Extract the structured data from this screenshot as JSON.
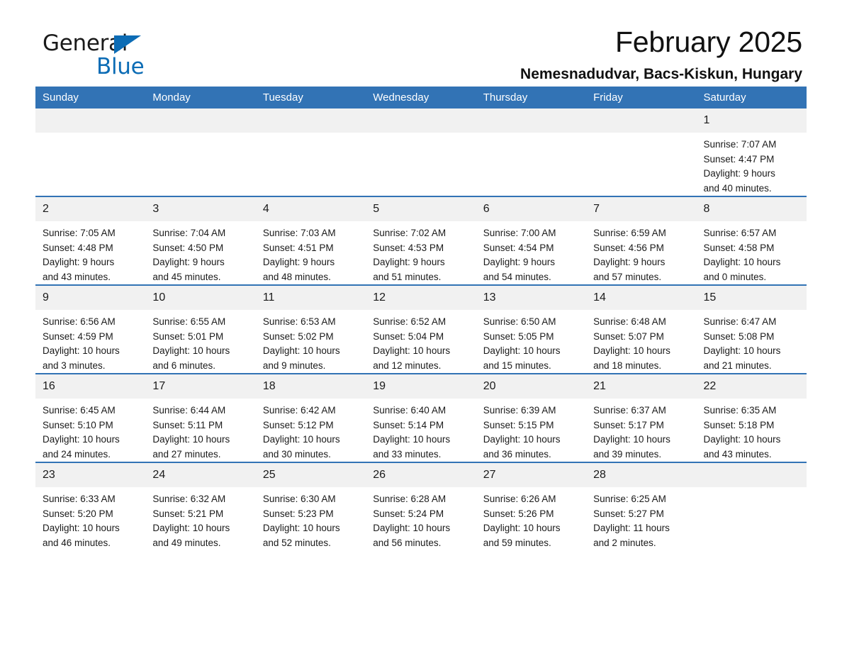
{
  "brand": {
    "name_part1": "General",
    "name_part2": "Blue",
    "triangle_color": "#0c6cb5"
  },
  "header": {
    "title": "February 2025",
    "subtitle": "Nemesnadudvar, Bacs-Kiskun, Hungary"
  },
  "colors": {
    "header_blue": "#3273b5",
    "day_band_gray": "#f1f1f1",
    "brand_blue": "#0c6cb5"
  },
  "weekday_headers": [
    "Sunday",
    "Monday",
    "Tuesday",
    "Wednesday",
    "Thursday",
    "Friday",
    "Saturday"
  ],
  "weeks": [
    [
      {
        "day": "",
        "sunrise": "",
        "sunset": "",
        "daylight_line1": "",
        "daylight_line2": "",
        "empty": true
      },
      {
        "day": "",
        "sunrise": "",
        "sunset": "",
        "daylight_line1": "",
        "daylight_line2": "",
        "empty": true
      },
      {
        "day": "",
        "sunrise": "",
        "sunset": "",
        "daylight_line1": "",
        "daylight_line2": "",
        "empty": true
      },
      {
        "day": "",
        "sunrise": "",
        "sunset": "",
        "daylight_line1": "",
        "daylight_line2": "",
        "empty": true
      },
      {
        "day": "",
        "sunrise": "",
        "sunset": "",
        "daylight_line1": "",
        "daylight_line2": "",
        "empty": true
      },
      {
        "day": "",
        "sunrise": "",
        "sunset": "",
        "daylight_line1": "",
        "daylight_line2": "",
        "empty": true
      },
      {
        "day": "1",
        "sunrise": "Sunrise: 7:07 AM",
        "sunset": "Sunset: 4:47 PM",
        "daylight_line1": "Daylight: 9 hours",
        "daylight_line2": "and 40 minutes.",
        "empty": false
      }
    ],
    [
      {
        "day": "2",
        "sunrise": "Sunrise: 7:05 AM",
        "sunset": "Sunset: 4:48 PM",
        "daylight_line1": "Daylight: 9 hours",
        "daylight_line2": "and 43 minutes.",
        "empty": false
      },
      {
        "day": "3",
        "sunrise": "Sunrise: 7:04 AM",
        "sunset": "Sunset: 4:50 PM",
        "daylight_line1": "Daylight: 9 hours",
        "daylight_line2": "and 45 minutes.",
        "empty": false
      },
      {
        "day": "4",
        "sunrise": "Sunrise: 7:03 AM",
        "sunset": "Sunset: 4:51 PM",
        "daylight_line1": "Daylight: 9 hours",
        "daylight_line2": "and 48 minutes.",
        "empty": false
      },
      {
        "day": "5",
        "sunrise": "Sunrise: 7:02 AM",
        "sunset": "Sunset: 4:53 PM",
        "daylight_line1": "Daylight: 9 hours",
        "daylight_line2": "and 51 minutes.",
        "empty": false
      },
      {
        "day": "6",
        "sunrise": "Sunrise: 7:00 AM",
        "sunset": "Sunset: 4:54 PM",
        "daylight_line1": "Daylight: 9 hours",
        "daylight_line2": "and 54 minutes.",
        "empty": false
      },
      {
        "day": "7",
        "sunrise": "Sunrise: 6:59 AM",
        "sunset": "Sunset: 4:56 PM",
        "daylight_line1": "Daylight: 9 hours",
        "daylight_line2": "and 57 minutes.",
        "empty": false
      },
      {
        "day": "8",
        "sunrise": "Sunrise: 6:57 AM",
        "sunset": "Sunset: 4:58 PM",
        "daylight_line1": "Daylight: 10 hours",
        "daylight_line2": "and 0 minutes.",
        "empty": false
      }
    ],
    [
      {
        "day": "9",
        "sunrise": "Sunrise: 6:56 AM",
        "sunset": "Sunset: 4:59 PM",
        "daylight_line1": "Daylight: 10 hours",
        "daylight_line2": "and 3 minutes.",
        "empty": false
      },
      {
        "day": "10",
        "sunrise": "Sunrise: 6:55 AM",
        "sunset": "Sunset: 5:01 PM",
        "daylight_line1": "Daylight: 10 hours",
        "daylight_line2": "and 6 minutes.",
        "empty": false
      },
      {
        "day": "11",
        "sunrise": "Sunrise: 6:53 AM",
        "sunset": "Sunset: 5:02 PM",
        "daylight_line1": "Daylight: 10 hours",
        "daylight_line2": "and 9 minutes.",
        "empty": false
      },
      {
        "day": "12",
        "sunrise": "Sunrise: 6:52 AM",
        "sunset": "Sunset: 5:04 PM",
        "daylight_line1": "Daylight: 10 hours",
        "daylight_line2": "and 12 minutes.",
        "empty": false
      },
      {
        "day": "13",
        "sunrise": "Sunrise: 6:50 AM",
        "sunset": "Sunset: 5:05 PM",
        "daylight_line1": "Daylight: 10 hours",
        "daylight_line2": "and 15 minutes.",
        "empty": false
      },
      {
        "day": "14",
        "sunrise": "Sunrise: 6:48 AM",
        "sunset": "Sunset: 5:07 PM",
        "daylight_line1": "Daylight: 10 hours",
        "daylight_line2": "and 18 minutes.",
        "empty": false
      },
      {
        "day": "15",
        "sunrise": "Sunrise: 6:47 AM",
        "sunset": "Sunset: 5:08 PM",
        "daylight_line1": "Daylight: 10 hours",
        "daylight_line2": "and 21 minutes.",
        "empty": false
      }
    ],
    [
      {
        "day": "16",
        "sunrise": "Sunrise: 6:45 AM",
        "sunset": "Sunset: 5:10 PM",
        "daylight_line1": "Daylight: 10 hours",
        "daylight_line2": "and 24 minutes.",
        "empty": false
      },
      {
        "day": "17",
        "sunrise": "Sunrise: 6:44 AM",
        "sunset": "Sunset: 5:11 PM",
        "daylight_line1": "Daylight: 10 hours",
        "daylight_line2": "and 27 minutes.",
        "empty": false
      },
      {
        "day": "18",
        "sunrise": "Sunrise: 6:42 AM",
        "sunset": "Sunset: 5:12 PM",
        "daylight_line1": "Daylight: 10 hours",
        "daylight_line2": "and 30 minutes.",
        "empty": false
      },
      {
        "day": "19",
        "sunrise": "Sunrise: 6:40 AM",
        "sunset": "Sunset: 5:14 PM",
        "daylight_line1": "Daylight: 10 hours",
        "daylight_line2": "and 33 minutes.",
        "empty": false
      },
      {
        "day": "20",
        "sunrise": "Sunrise: 6:39 AM",
        "sunset": "Sunset: 5:15 PM",
        "daylight_line1": "Daylight: 10 hours",
        "daylight_line2": "and 36 minutes.",
        "empty": false
      },
      {
        "day": "21",
        "sunrise": "Sunrise: 6:37 AM",
        "sunset": "Sunset: 5:17 PM",
        "daylight_line1": "Daylight: 10 hours",
        "daylight_line2": "and 39 minutes.",
        "empty": false
      },
      {
        "day": "22",
        "sunrise": "Sunrise: 6:35 AM",
        "sunset": "Sunset: 5:18 PM",
        "daylight_line1": "Daylight: 10 hours",
        "daylight_line2": "and 43 minutes.",
        "empty": false
      }
    ],
    [
      {
        "day": "23",
        "sunrise": "Sunrise: 6:33 AM",
        "sunset": "Sunset: 5:20 PM",
        "daylight_line1": "Daylight: 10 hours",
        "daylight_line2": "and 46 minutes.",
        "empty": false
      },
      {
        "day": "24",
        "sunrise": "Sunrise: 6:32 AM",
        "sunset": "Sunset: 5:21 PM",
        "daylight_line1": "Daylight: 10 hours",
        "daylight_line2": "and 49 minutes.",
        "empty": false
      },
      {
        "day": "25",
        "sunrise": "Sunrise: 6:30 AM",
        "sunset": "Sunset: 5:23 PM",
        "daylight_line1": "Daylight: 10 hours",
        "daylight_line2": "and 52 minutes.",
        "empty": false
      },
      {
        "day": "26",
        "sunrise": "Sunrise: 6:28 AM",
        "sunset": "Sunset: 5:24 PM",
        "daylight_line1": "Daylight: 10 hours",
        "daylight_line2": "and 56 minutes.",
        "empty": false
      },
      {
        "day": "27",
        "sunrise": "Sunrise: 6:26 AM",
        "sunset": "Sunset: 5:26 PM",
        "daylight_line1": "Daylight: 10 hours",
        "daylight_line2": "and 59 minutes.",
        "empty": false
      },
      {
        "day": "28",
        "sunrise": "Sunrise: 6:25 AM",
        "sunset": "Sunset: 5:27 PM",
        "daylight_line1": "Daylight: 11 hours",
        "daylight_line2": "and 2 minutes.",
        "empty": false
      },
      {
        "day": "",
        "sunrise": "",
        "sunset": "",
        "daylight_line1": "",
        "daylight_line2": "",
        "empty": true
      }
    ]
  ]
}
